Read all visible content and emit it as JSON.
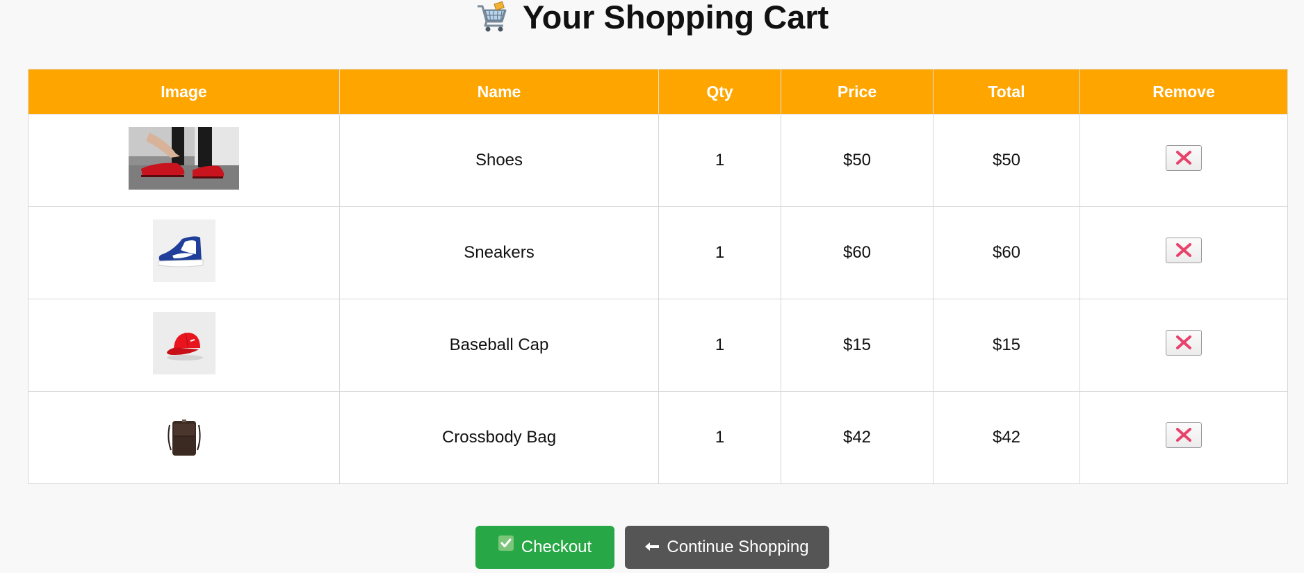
{
  "header": {
    "title": "Your Shopping Cart",
    "icon": "shopping-cart-icon"
  },
  "table": {
    "columns": [
      "Image",
      "Name",
      "Qty",
      "Price",
      "Total",
      "Remove"
    ],
    "rows": [
      {
        "name": "Shoes",
        "qty": "1",
        "price": "$50",
        "total": "$50",
        "image": "red-shoes-photo"
      },
      {
        "name": "Sneakers",
        "qty": "1",
        "price": "$60",
        "total": "$60",
        "image": "blue-sneaker-photo"
      },
      {
        "name": "Baseball Cap",
        "qty": "1",
        "price": "$15",
        "total": "$15",
        "image": "red-cap-photo"
      },
      {
        "name": "Crossbody Bag",
        "qty": "1",
        "price": "$42",
        "total": "$42",
        "image": "brown-bag-photo"
      }
    ]
  },
  "actions": {
    "checkout_label": "Checkout",
    "continue_label": "Continue Shopping"
  },
  "colors": {
    "header_bg": "#ffa500",
    "checkout_bg": "#27a745",
    "continue_bg": "#555555",
    "remove_x": "#e8426a"
  }
}
